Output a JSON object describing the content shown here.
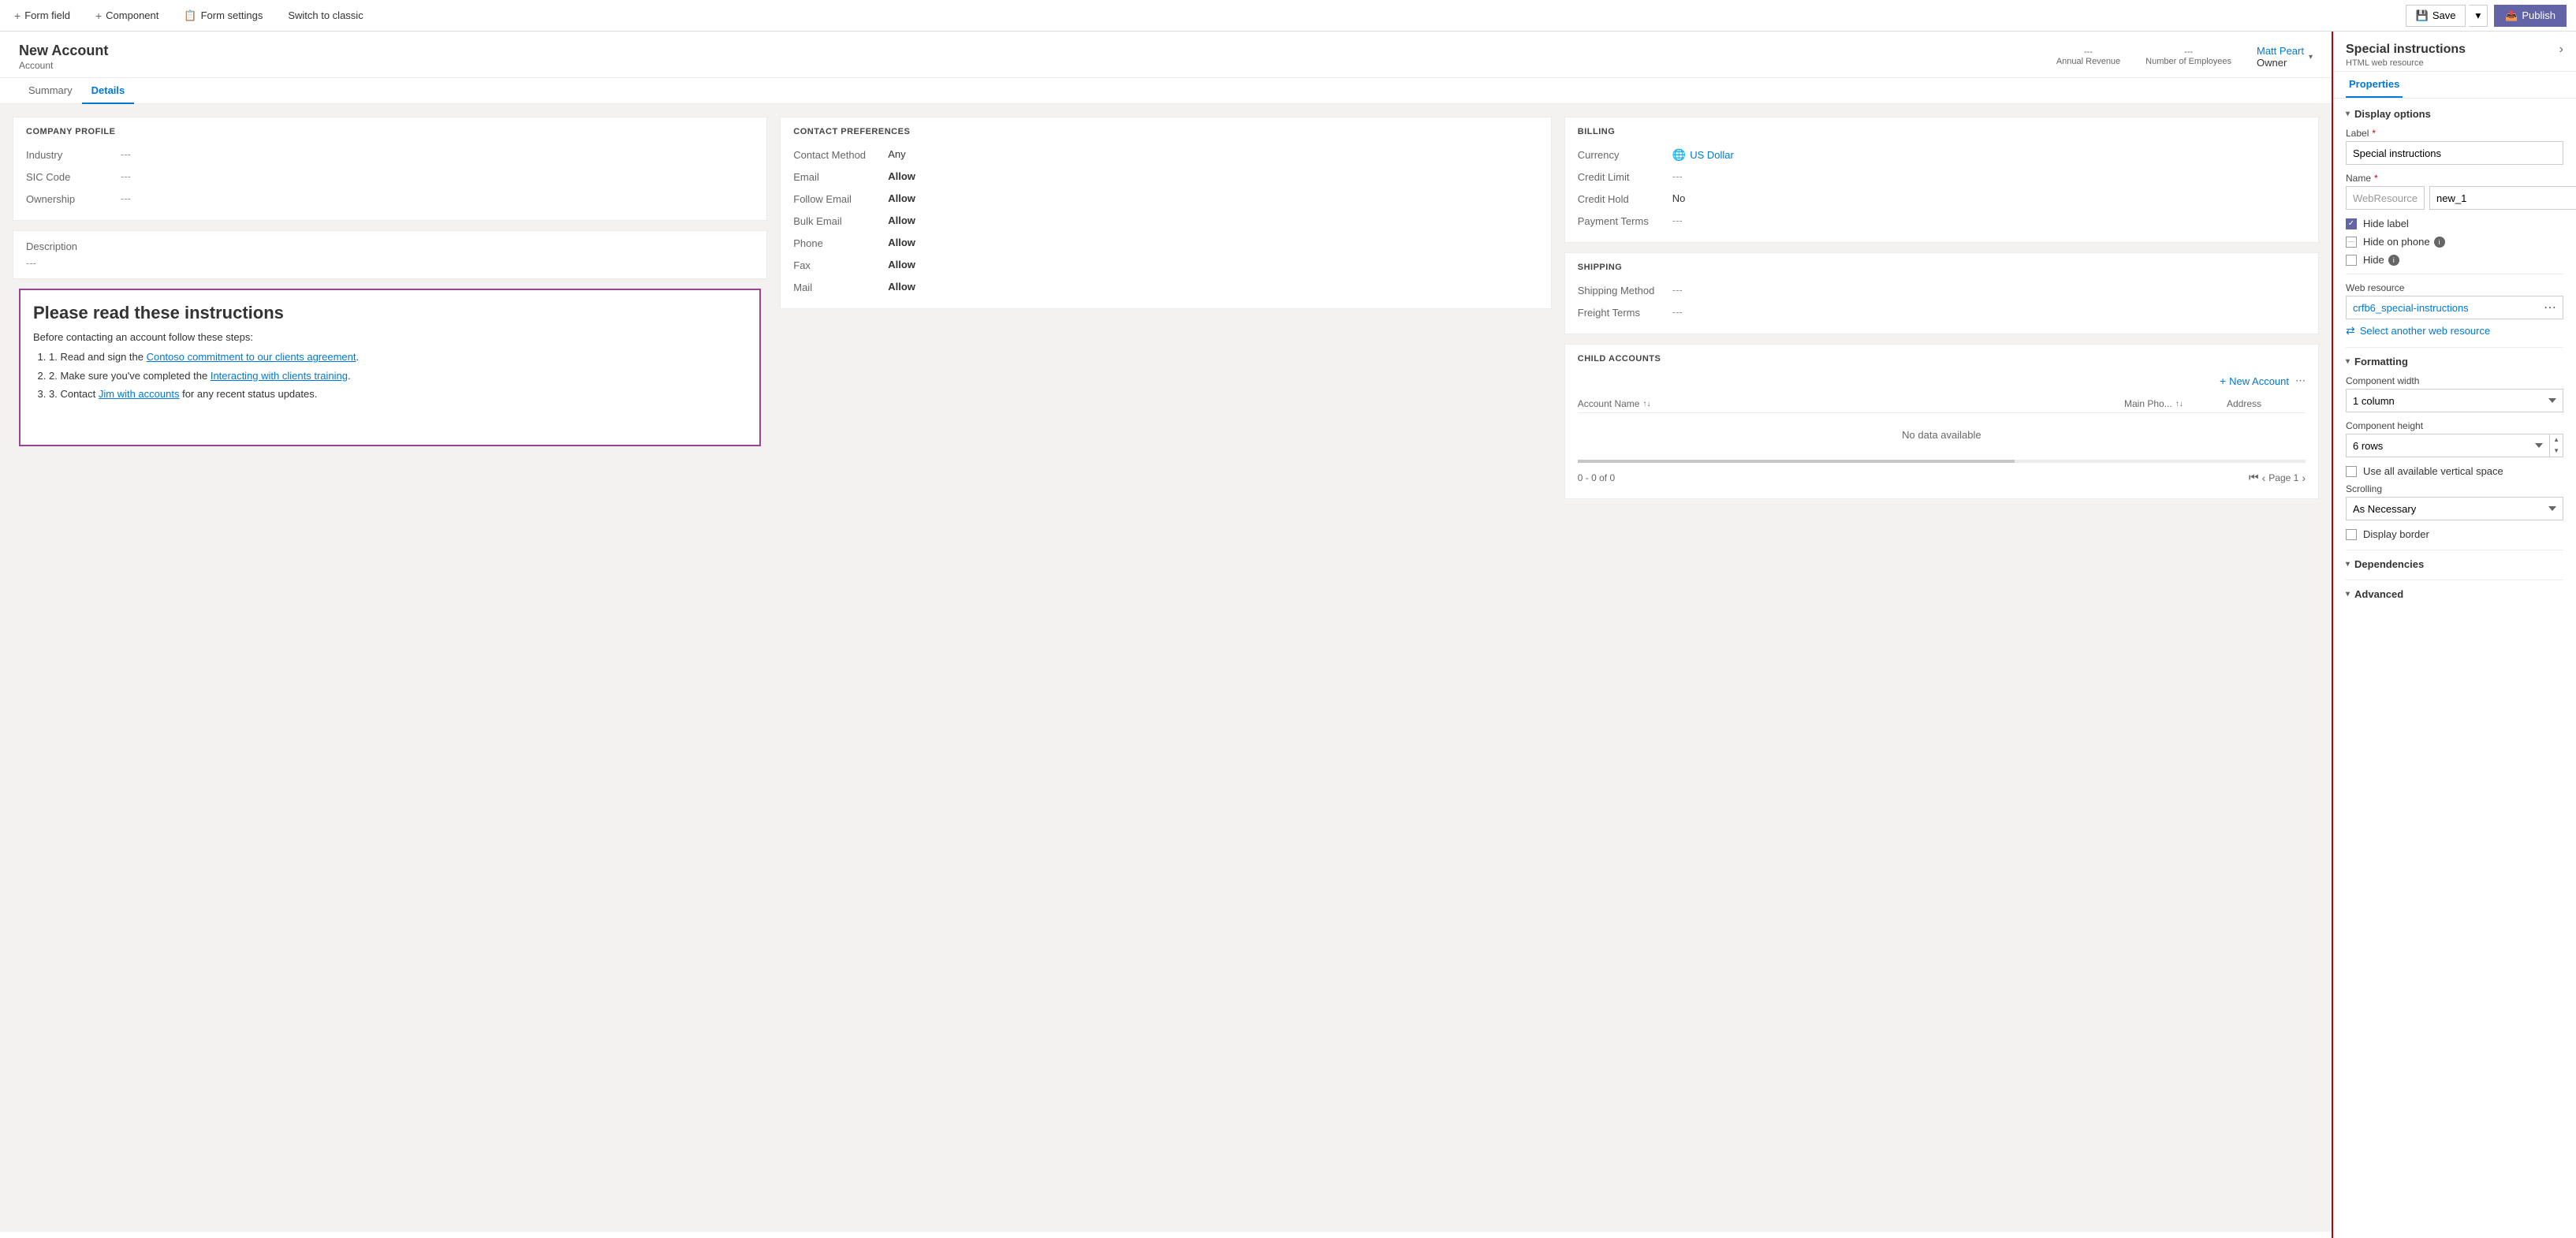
{
  "toolbar": {
    "form_field_label": "Form field",
    "component_label": "Component",
    "form_settings_label": "Form settings",
    "switch_label": "Switch to classic",
    "save_label": "Save",
    "publish_label": "Publish"
  },
  "account": {
    "name": "New Account",
    "type": "Account",
    "annual_revenue_label": "---",
    "annual_revenue_field": "Annual Revenue",
    "employees_label": "---",
    "employees_field": "Number of Employees",
    "owner_name": "Matt Peart",
    "owner_label": "Owner"
  },
  "tabs": {
    "summary": "Summary",
    "details": "Details"
  },
  "company_profile": {
    "title": "COMPANY PROFILE",
    "industry_label": "Industry",
    "industry_value": "---",
    "sic_label": "SIC Code",
    "sic_value": "---",
    "ownership_label": "Ownership",
    "ownership_value": "---"
  },
  "description": {
    "label": "Description",
    "value": "---"
  },
  "instructions": {
    "title": "Please read these instructions",
    "subtitle": "Before contacting an account follow these steps:",
    "item1_pre": "1. Read and sign the ",
    "item1_link": "Contoso commitment to our clients agreement",
    "item1_post": ".",
    "item2_pre": "2. Make sure you've completed the ",
    "item2_link": "Interacting with clients training",
    "item2_post": ".",
    "item3_pre": "3. Contact ",
    "item3_link": "Jim with accounts",
    "item3_post": " for any recent status updates."
  },
  "contact_preferences": {
    "title": "CONTACT PREFERENCES",
    "contact_method_label": "Contact Method",
    "contact_method_value": "Any",
    "email_label": "Email",
    "email_value": "Allow",
    "follow_email_label": "Follow Email",
    "follow_email_value": "Allow",
    "bulk_email_label": "Bulk Email",
    "bulk_email_value": "Allow",
    "phone_label": "Phone",
    "phone_value": "Allow",
    "fax_label": "Fax",
    "fax_value": "Allow",
    "mail_label": "Mail",
    "mail_value": "Allow"
  },
  "billing": {
    "title": "BILLING",
    "currency_label": "Currency",
    "currency_value": "US Dollar",
    "credit_limit_label": "Credit Limit",
    "credit_limit_value": "---",
    "credit_hold_label": "Credit Hold",
    "credit_hold_value": "No",
    "payment_terms_label": "Payment Terms",
    "payment_terms_value": "---"
  },
  "shipping": {
    "title": "SHIPPING",
    "shipping_method_label": "Shipping Method",
    "shipping_method_value": "---",
    "freight_terms_label": "Freight Terms",
    "freight_terms_value": "---"
  },
  "child_accounts": {
    "title": "CHILD ACCOUNTS",
    "new_btn": "New Account",
    "col_name": "Account Name",
    "col_phone": "Main Pho...",
    "col_address": "Address",
    "no_data": "No data available",
    "pagination_info": "0 - 0 of 0",
    "page_label": "Page 1"
  },
  "panel": {
    "title": "Special instructions",
    "subtitle": "HTML web resource",
    "tab_properties": "Properties",
    "section_display": "Display options",
    "label_field_label": "Label",
    "label_required": "*",
    "label_value": "Special instructions",
    "name_field_label": "Name",
    "name_required": "*",
    "name_prefix": "WebResource_",
    "name_value": "new_1",
    "hide_label_text": "Hide label",
    "hide_phone_text": "Hide on phone",
    "hide_text": "Hide",
    "web_resource_label": "Web resource",
    "web_resource_name": "crfb6_special-instructions",
    "select_web_resource": "Select another web resource",
    "section_formatting": "Formatting",
    "component_width_label": "Component width",
    "component_width_value": "1 column",
    "component_height_label": "Component height",
    "component_height_value": "6 rows",
    "use_vertical_label": "Use all available vertical space",
    "scrolling_label": "Scrolling",
    "scrolling_value": "As Necessary",
    "display_border_label": "Display border",
    "section_dependencies": "Dependencies",
    "section_advanced": "Advanced"
  }
}
